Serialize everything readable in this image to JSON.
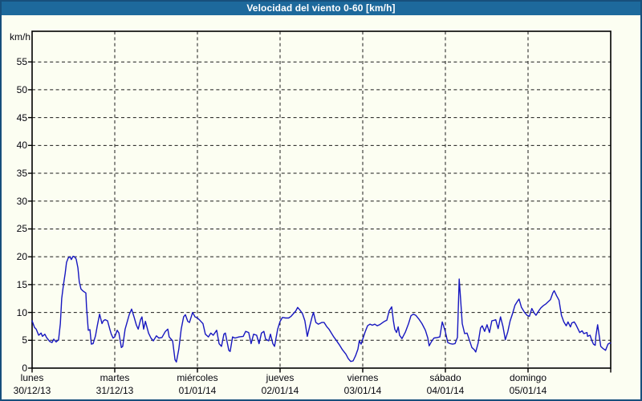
{
  "title": "Velocidad del viento 0-60 [km/h]",
  "colors": {
    "title_bar": "#1d699c",
    "frame_border": "#174f7c",
    "background": "#fcfef2",
    "line": "#1717c0",
    "grid": "#1a1a1a",
    "axis": "#000000",
    "text": "#06060e",
    "title_text": "#ffffff"
  },
  "chart_data": {
    "type": "line",
    "title": "Velocidad del viento 0-60 [km/h]",
    "ylabel": "km/h",
    "xlabel": "",
    "ylim": [
      0,
      60
    ],
    "yticks": [
      0,
      5,
      10,
      15,
      20,
      25,
      30,
      35,
      40,
      45,
      50,
      55
    ],
    "grid": "dashed",
    "legend_position": "none",
    "x_unit": "hours since Monday 00:00",
    "xlim": [
      0,
      168
    ],
    "days": [
      {
        "name": "lunes",
        "date": "30/12/13"
      },
      {
        "name": "martes",
        "date": "31/12/13"
      },
      {
        "name": "miércoles",
        "date": "01/01/14"
      },
      {
        "name": "jueves",
        "date": "02/01/14"
      },
      {
        "name": "viernes",
        "date": "03/01/14"
      },
      {
        "name": "sábado",
        "date": "04/01/14"
      },
      {
        "name": "domingo",
        "date": "05/01/14"
      }
    ],
    "series": [
      {
        "name": "Velocidad del viento (km/h)",
        "points": [
          [
            0,
            8.5
          ],
          [
            0.7,
            7.3
          ],
          [
            1.2,
            7
          ],
          [
            1.9,
            5.9
          ],
          [
            2.6,
            6.3
          ],
          [
            3,
            5.7
          ],
          [
            3.7,
            6.1
          ],
          [
            4.2,
            5.5
          ],
          [
            5.1,
            4.8
          ],
          [
            5.8,
            4.6
          ],
          [
            6.3,
            5.2
          ],
          [
            7,
            4.7
          ],
          [
            7.7,
            5.1
          ],
          [
            8.2,
            8
          ],
          [
            8.6,
            12.5
          ],
          [
            9.1,
            15
          ],
          [
            9.6,
            17
          ],
          [
            10,
            19
          ],
          [
            10.5,
            19.8
          ],
          [
            11,
            20
          ],
          [
            11.4,
            19.5
          ],
          [
            11.9,
            20.1
          ],
          [
            12.3,
            20
          ],
          [
            12.8,
            19.6
          ],
          [
            13.3,
            18
          ],
          [
            13.7,
            15.5
          ],
          [
            14.2,
            14.2
          ],
          [
            14.9,
            13.8
          ],
          [
            15.6,
            13.5
          ],
          [
            15.8,
            11
          ],
          [
            16.3,
            6.8
          ],
          [
            16.8,
            6.9
          ],
          [
            17.2,
            4.3
          ],
          [
            17.7,
            4.4
          ],
          [
            18.4,
            5.8
          ],
          [
            18.9,
            7.5
          ],
          [
            19.6,
            9.7
          ],
          [
            20.3,
            8
          ],
          [
            20.7,
            8.5
          ],
          [
            21.2,
            8.7
          ],
          [
            21.9,
            8.5
          ],
          [
            22.6,
            6.9
          ],
          [
            23,
            6.1
          ],
          [
            23.5,
            5.4
          ],
          [
            24,
            5.6
          ],
          [
            24.7,
            6.8
          ],
          [
            25.2,
            6.3
          ],
          [
            25.9,
            3.7
          ],
          [
            26.3,
            3.9
          ],
          [
            27,
            7
          ],
          [
            28.2,
            9.6
          ],
          [
            28.9,
            10.6
          ],
          [
            29.6,
            9.2
          ],
          [
            30.3,
            7.7
          ],
          [
            30.8,
            7
          ],
          [
            31.5,
            8.7
          ],
          [
            31.9,
            9.2
          ],
          [
            32.4,
            7
          ],
          [
            32.9,
            8.4
          ],
          [
            33.8,
            6.3
          ],
          [
            34.5,
            5.4
          ],
          [
            35.2,
            4.9
          ],
          [
            36.1,
            5.8
          ],
          [
            36.8,
            5.4
          ],
          [
            37.7,
            5.5
          ],
          [
            38.7,
            6.6
          ],
          [
            39.4,
            7
          ],
          [
            39.8,
            5.6
          ],
          [
            40.8,
            4.9
          ],
          [
            41.5,
            1.5
          ],
          [
            41.9,
            1.1
          ],
          [
            42.6,
            3.4
          ],
          [
            43.3,
            7
          ],
          [
            44,
            9.2
          ],
          [
            44.5,
            9.6
          ],
          [
            45.2,
            8.4
          ],
          [
            45.7,
            8.2
          ],
          [
            46.6,
            10
          ],
          [
            47.3,
            9.2
          ],
          [
            48,
            9
          ],
          [
            48.7,
            8.6
          ],
          [
            49.6,
            8
          ],
          [
            50.3,
            6.1
          ],
          [
            51.2,
            5.6
          ],
          [
            51.9,
            6.3
          ],
          [
            52.6,
            5.9
          ],
          [
            53.6,
            6.8
          ],
          [
            54.3,
            4.4
          ],
          [
            55,
            3.9
          ],
          [
            55.7,
            6.1
          ],
          [
            56.1,
            6.3
          ],
          [
            57.1,
            3.2
          ],
          [
            57.5,
            3
          ],
          [
            58.2,
            5.6
          ],
          [
            58.9,
            5.4
          ],
          [
            60.1,
            5.6
          ],
          [
            61.3,
            5.7
          ],
          [
            62,
            6.6
          ],
          [
            62.9,
            6.4
          ],
          [
            63.6,
            4.4
          ],
          [
            64.3,
            6.1
          ],
          [
            65.2,
            5.9
          ],
          [
            65.9,
            4.4
          ],
          [
            66.6,
            6.3
          ],
          [
            67.3,
            6.6
          ],
          [
            67.8,
            5.2
          ],
          [
            68.7,
            4.9
          ],
          [
            69.2,
            6.1
          ],
          [
            69.9,
            4.4
          ],
          [
            70.4,
            3.9
          ],
          [
            71.3,
            7
          ],
          [
            72,
            8.4
          ],
          [
            72.7,
            9.1
          ],
          [
            73.6,
            9
          ],
          [
            74.5,
            9
          ],
          [
            75.2,
            9.3
          ],
          [
            75.9,
            9.8
          ],
          [
            76.6,
            10.3
          ],
          [
            77.1,
            10.9
          ],
          [
            77.8,
            10.4
          ],
          [
            78.5,
            9.8
          ],
          [
            79.2,
            8.5
          ],
          [
            79.9,
            5.7
          ],
          [
            80.6,
            7.5
          ],
          [
            81.3,
            9.2
          ],
          [
            81.7,
            10
          ],
          [
            82.4,
            8.2
          ],
          [
            83.1,
            7.9
          ],
          [
            84.1,
            8.2
          ],
          [
            84.8,
            8.2
          ],
          [
            85.5,
            7.5
          ],
          [
            86.2,
            7
          ],
          [
            86.9,
            6.3
          ],
          [
            87.6,
            5.6
          ],
          [
            88.3,
            5
          ],
          [
            89.2,
            4.2
          ],
          [
            90.1,
            3.3
          ],
          [
            91.1,
            2.5
          ],
          [
            91.8,
            1.7
          ],
          [
            92.5,
            1.2
          ],
          [
            93.2,
            1.3
          ],
          [
            93.9,
            2.2
          ],
          [
            94.6,
            3.4
          ],
          [
            95,
            4.9
          ],
          [
            95.5,
            4.3
          ],
          [
            96,
            5.2
          ],
          [
            96.7,
            6.5
          ],
          [
            97.4,
            7.6
          ],
          [
            98.1,
            7.9
          ],
          [
            98.8,
            7.7
          ],
          [
            99.5,
            7.9
          ],
          [
            100.2,
            7.6
          ],
          [
            100.9,
            7.8
          ],
          [
            101.6,
            8.1
          ],
          [
            102.3,
            8.4
          ],
          [
            103,
            8.6
          ],
          [
            103.7,
            10.3
          ],
          [
            104.4,
            11
          ],
          [
            104.9,
            8.5
          ],
          [
            105.3,
            7
          ],
          [
            105.8,
            6.4
          ],
          [
            106.3,
            7.4
          ],
          [
            106.7,
            5.9
          ],
          [
            107.4,
            5.3
          ],
          [
            108.4,
            6.5
          ],
          [
            109.3,
            8
          ],
          [
            110,
            9.4
          ],
          [
            110.7,
            9.7
          ],
          [
            111.4,
            9.5
          ],
          [
            112.3,
            8.8
          ],
          [
            113.2,
            8
          ],
          [
            114.2,
            6.8
          ],
          [
            114.9,
            5.4
          ],
          [
            115.3,
            4
          ],
          [
            116,
            4.8
          ],
          [
            116.7,
            5.4
          ],
          [
            117.7,
            5.5
          ],
          [
            118.4,
            5.6
          ],
          [
            119.1,
            8.3
          ],
          [
            119.5,
            7.5
          ],
          [
            120,
            6.5
          ],
          [
            120.7,
            4.6
          ],
          [
            121.4,
            4.4
          ],
          [
            122.1,
            4.3
          ],
          [
            122.8,
            4.4
          ],
          [
            123.5,
            5.5
          ],
          [
            124,
            16
          ],
          [
            124.4,
            12.5
          ],
          [
            124.9,
            8
          ],
          [
            125.6,
            6.2
          ],
          [
            126.3,
            6.3
          ],
          [
            127,
            5
          ],
          [
            127.7,
            3.7
          ],
          [
            128.4,
            3.3
          ],
          [
            128.8,
            2.9
          ],
          [
            129.5,
            4.5
          ],
          [
            130.2,
            7.2
          ],
          [
            130.7,
            7.6
          ],
          [
            131.4,
            6.6
          ],
          [
            132.1,
            7.8
          ],
          [
            132.8,
            6.4
          ],
          [
            133.5,
            8.5
          ],
          [
            134.2,
            8.6
          ],
          [
            134.6,
            8.7
          ],
          [
            135.3,
            7.1
          ],
          [
            136,
            9.2
          ],
          [
            136.7,
            7.5
          ],
          [
            137.4,
            5.1
          ],
          [
            138.1,
            6.5
          ],
          [
            138.8,
            8.5
          ],
          [
            139.5,
            9.8
          ],
          [
            140.2,
            11.3
          ],
          [
            140.9,
            12
          ],
          [
            141.4,
            12.4
          ],
          [
            142.1,
            10.9
          ],
          [
            143,
            10
          ],
          [
            143.7,
            9.5
          ],
          [
            144.4,
            9.3
          ],
          [
            145.1,
            10.7
          ],
          [
            145.8,
            9.9
          ],
          [
            146.3,
            9.5
          ],
          [
            147,
            10.2
          ],
          [
            147.7,
            10.8
          ],
          [
            148.4,
            11.2
          ],
          [
            149.1,
            11.5
          ],
          [
            149.8,
            11.9
          ],
          [
            150.5,
            12.3
          ],
          [
            151.2,
            13.5
          ],
          [
            151.6,
            13.9
          ],
          [
            152.3,
            13
          ],
          [
            153,
            12.2
          ],
          [
            153.7,
            9.5
          ],
          [
            154.4,
            8.3
          ],
          [
            155.1,
            7.6
          ],
          [
            155.6,
            8.3
          ],
          [
            156.3,
            7.4
          ],
          [
            156.7,
            8.1
          ],
          [
            157.4,
            8.3
          ],
          [
            157.9,
            7.8
          ],
          [
            158.6,
            6.9
          ],
          [
            159,
            6.4
          ],
          [
            159.7,
            6.7
          ],
          [
            160.2,
            6.2
          ],
          [
            161.1,
            6.4
          ],
          [
            161.3,
            5.7
          ],
          [
            162,
            5.9
          ],
          [
            162.5,
            5
          ],
          [
            163,
            4.3
          ],
          [
            163.5,
            4.1
          ],
          [
            163.7,
            5.7
          ],
          [
            164.2,
            7.8
          ],
          [
            164.9,
            4.8
          ],
          [
            165.1,
            3.9
          ],
          [
            165.8,
            3.5
          ],
          [
            166.5,
            3.2
          ],
          [
            167.2,
            4.3
          ],
          [
            167.7,
            4.5
          ],
          [
            168,
            4.5
          ]
        ]
      }
    ]
  }
}
